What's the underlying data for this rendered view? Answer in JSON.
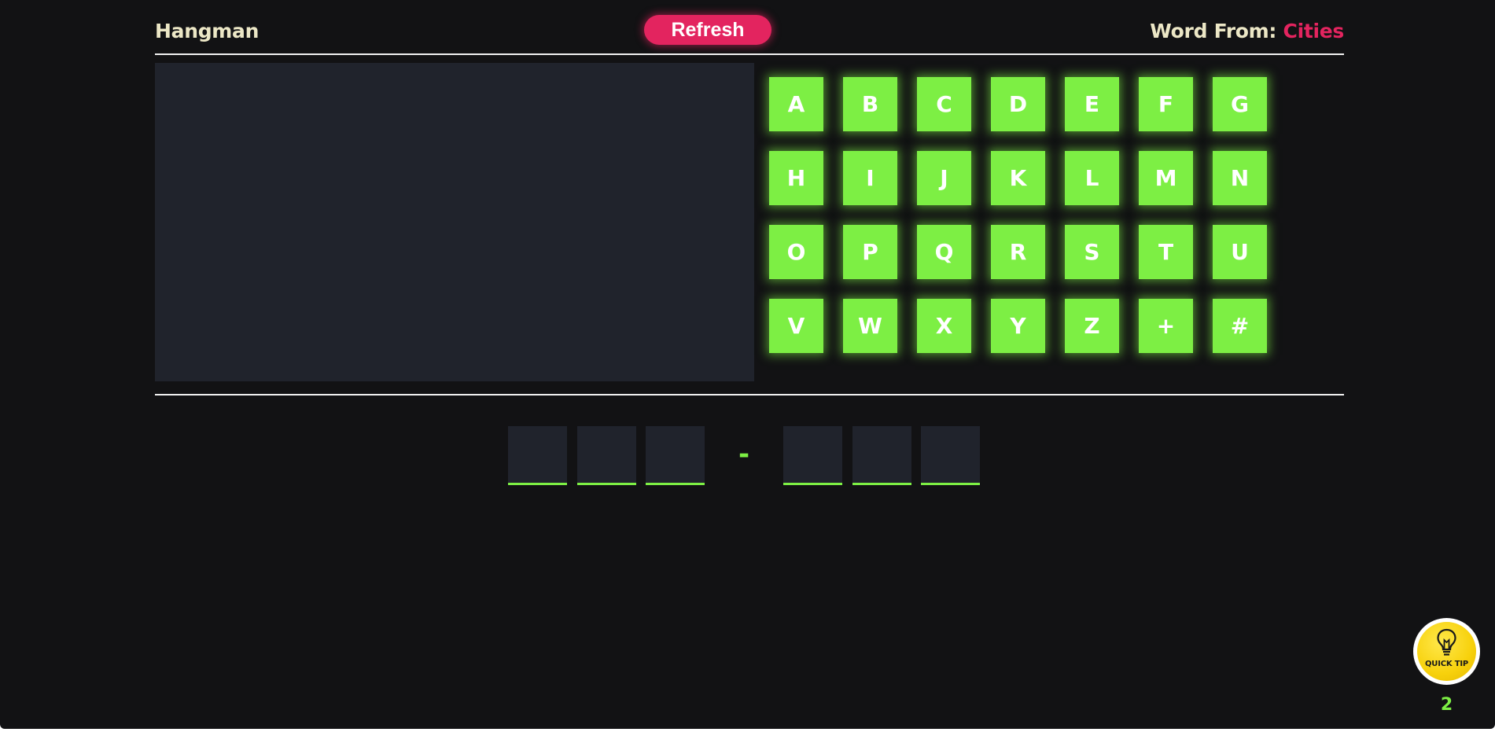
{
  "header": {
    "title": "Hangman",
    "refresh_label": "Refresh",
    "word_from_label": "Word From:",
    "category": "Cities"
  },
  "keyboard": {
    "keys": [
      "A",
      "B",
      "C",
      "D",
      "E",
      "F",
      "G",
      "H",
      "I",
      "J",
      "K",
      "L",
      "M",
      "N",
      "O",
      "P",
      "Q",
      "R",
      "S",
      "T",
      "U",
      "V",
      "W",
      "X",
      "Y",
      "Z",
      "+",
      "#"
    ]
  },
  "answer": {
    "pattern": [
      "_",
      "_",
      "_",
      "-",
      "_",
      "_",
      "_"
    ],
    "separator": "-"
  },
  "quick_tip": {
    "label": "QUICK TIP",
    "remaining": "2",
    "icon": "lightbulb-icon"
  },
  "colors": {
    "background": "#121214",
    "panel": "#20232c",
    "key": "#7def44",
    "accent": "#e3245f",
    "text": "#ece7c6",
    "tip": "#f7d10c"
  }
}
